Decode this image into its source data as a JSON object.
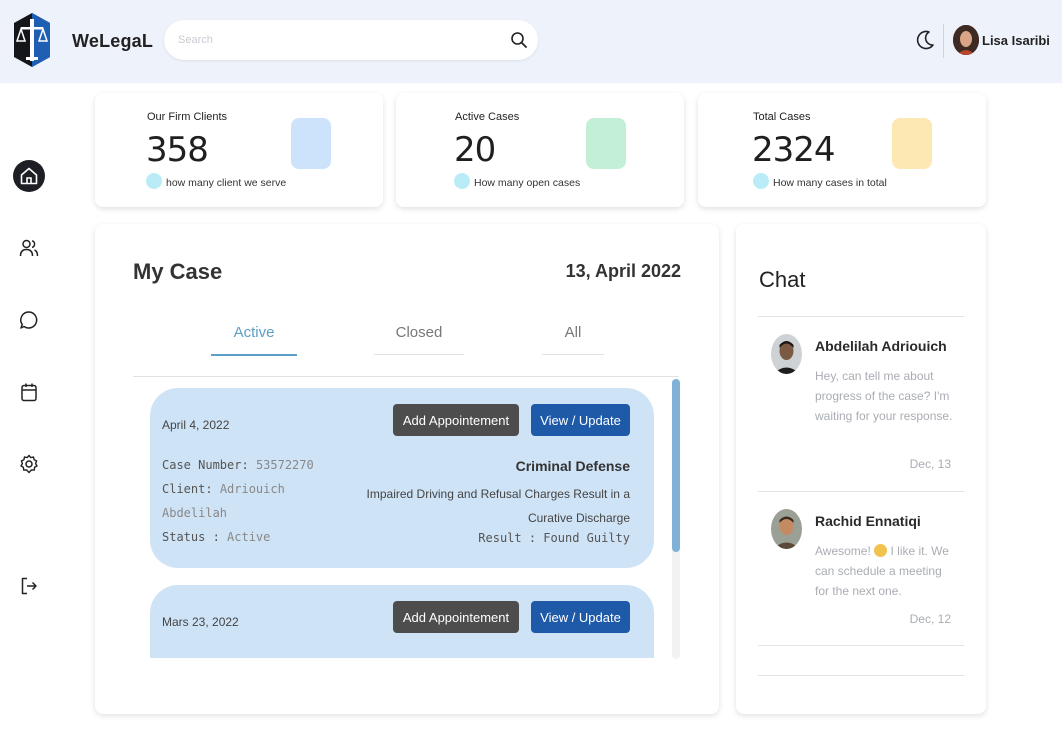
{
  "header": {
    "brand": "WeLegaL",
    "search_placeholder": "Search",
    "user_name": "Lisa Isaribi"
  },
  "sidebar": {
    "items": [
      {
        "icon": "home-icon",
        "active": true
      },
      {
        "icon": "users-icon",
        "active": false
      },
      {
        "icon": "chat-icon",
        "active": false
      },
      {
        "icon": "calendar-icon",
        "active": false
      },
      {
        "icon": "gear-icon",
        "active": false
      },
      {
        "icon": "logout-icon",
        "active": false
      }
    ]
  },
  "stats": [
    {
      "label": "Our Firm Clients",
      "value": "358",
      "desc": "how many client we serve",
      "color": "#cde3fb"
    },
    {
      "label": "Active Cases",
      "value": "20",
      "desc": "How many open cases",
      "color": "#c3efd6"
    },
    {
      "label": "Total Cases",
      "value": "2324",
      "desc": "How many cases in total",
      "color": "#fde7b3"
    }
  ],
  "cases": {
    "title": "My Case",
    "date": "13, April 2022",
    "tabs": [
      {
        "label": "Active",
        "active": true
      },
      {
        "label": "Closed",
        "active": false
      },
      {
        "label": "All",
        "active": false
      }
    ],
    "items": [
      {
        "date": "April 4, 2022",
        "add_label": "Add Appointement",
        "view_label": "View / Update",
        "case_number_key": "Case Number:",
        "case_number": "53572270",
        "client_key": "Client:",
        "client_first": "Adriouich",
        "client_last": "Abdelilah",
        "status_key": "Status :",
        "status": "Active",
        "type": "Criminal Defense",
        "charge_line1": "Impaired Driving and Refusal Charges Result in a",
        "charge_line2": "Curative Discharge",
        "result_key": "Result :",
        "result": "Found Guilty"
      },
      {
        "date": "Mars 23, 2022",
        "add_label": "Add Appointement",
        "view_label": "View / Update"
      }
    ]
  },
  "chat": {
    "title": "Chat",
    "messages": [
      {
        "name": "Abdelilah Adriouich",
        "text": "Hey, can tell me about progress of the case? I'm waiting for your response.",
        "time": "Dec, 13"
      },
      {
        "name": "Rachid Ennatiqi",
        "text_before": "Awesome!",
        "text_after": "I like it. We can schedule a meeting for the next one.",
        "time": "Dec, 12"
      }
    ]
  }
}
